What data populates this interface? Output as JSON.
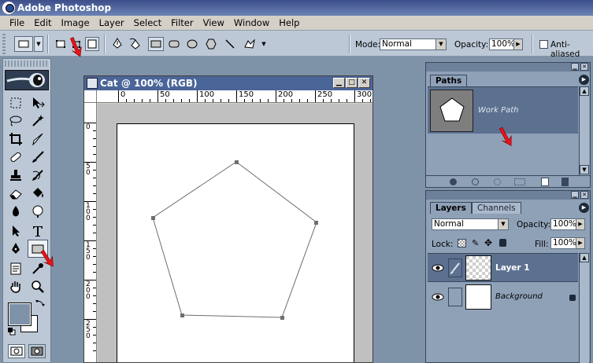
{
  "window": {
    "title": "Adobe Photoshop"
  },
  "menu": [
    "File",
    "Edit",
    "Image",
    "Layer",
    "Select",
    "Filter",
    "View",
    "Window",
    "Help"
  ],
  "options": {
    "mode_label": "Mode:",
    "mode_value": "Normal",
    "opacity_label": "Opacity:",
    "opacity_value": "100%",
    "antialias_label": "Anti-aliased"
  },
  "document": {
    "title": "Cat @ 100% (RGB)",
    "ruler_h_labels": [
      "0",
      "50",
      "100",
      "150",
      "200",
      "250",
      "300"
    ],
    "ruler_v_labels": [
      "0",
      "5 0",
      "1 0 0",
      "1 5 0",
      "2 0 0",
      "2 5 0"
    ]
  },
  "paths_panel": {
    "tab": "Paths",
    "item_label": "Work Path"
  },
  "layers_panel": {
    "tab_layers": "Layers",
    "tab_channels": "Channels",
    "blend_value": "Normal",
    "opacity_label": "Opacity:",
    "opacity_value": "100%",
    "lock_label": "Lock:",
    "fill_label": "Fill:",
    "fill_value": "100%",
    "layers": [
      {
        "name": "Layer 1"
      },
      {
        "name": "Background"
      }
    ]
  },
  "colors": {
    "workspace": "#7f93a8",
    "titlebar": "#4a6598",
    "selected_row": "#5c7190",
    "annotation": "#e8141a"
  }
}
